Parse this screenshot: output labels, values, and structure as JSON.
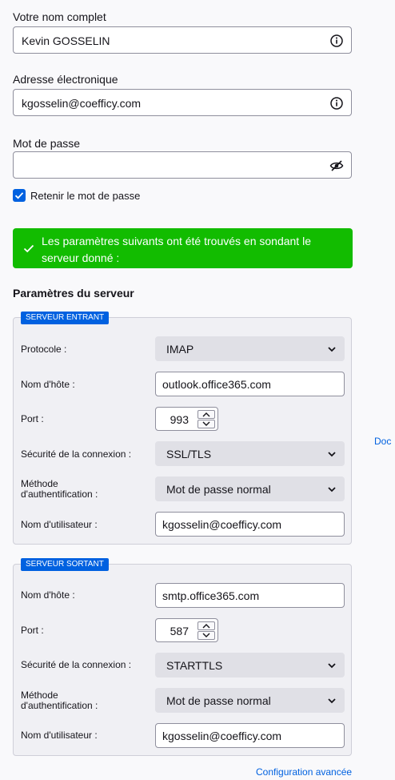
{
  "account": {
    "name_label": "Votre nom complet",
    "name_value": "Kevin GOSSELIN",
    "email_label": "Adresse électronique",
    "email_value": "kgosselin@coefficy.com",
    "password_label": "Mot de passe",
    "password_value": "",
    "remember_label": "Retenir le mot de passe",
    "remember_checked": true
  },
  "banner": {
    "message": "Les paramètres suivants ont été trouvés en sondant le serveur donné :",
    "color": "#12bc00"
  },
  "server_settings": {
    "title": "Paramètres du serveur",
    "incoming": {
      "tag": "SERVEUR ENTRANT",
      "protocol_label": "Protocole :",
      "protocol_value": "IMAP",
      "hostname_label": "Nom d'hôte :",
      "hostname_value": "outlook.office365.com",
      "port_label": "Port :",
      "port_value": "993",
      "security_label": "Sécurité de la connexion :",
      "security_value": "SSL/TLS",
      "auth_label_line1": "Méthode",
      "auth_label_line2": "d'authentification :",
      "auth_value": "Mot de passe normal",
      "username_label": "Nom d'utilisateur :",
      "username_value": "kgosselin@coefficy.com"
    },
    "outgoing": {
      "tag": "SERVEUR SORTANT",
      "hostname_label": "Nom d'hôte :",
      "hostname_value": "smtp.office365.com",
      "port_label": "Port :",
      "port_value": "587",
      "security_label": "Sécurité de la connexion :",
      "security_value": "STARTTLS",
      "auth_label_line1": "Méthode",
      "auth_label_line2": "d'authentification :",
      "auth_value": "Mot de passe normal",
      "username_label": "Nom d'utilisateur :",
      "username_value": "kgosselin@coefficy.com"
    }
  },
  "links": {
    "side_link": "Doc",
    "advanced": "Configuration avancée"
  },
  "colors": {
    "accent": "#0061e0",
    "success": "#12bc00"
  },
  "icons": [
    "info-icon",
    "eye-slash-icon",
    "check-icon",
    "chevron-down-icon",
    "spinner-up-icon",
    "spinner-down-icon"
  ]
}
